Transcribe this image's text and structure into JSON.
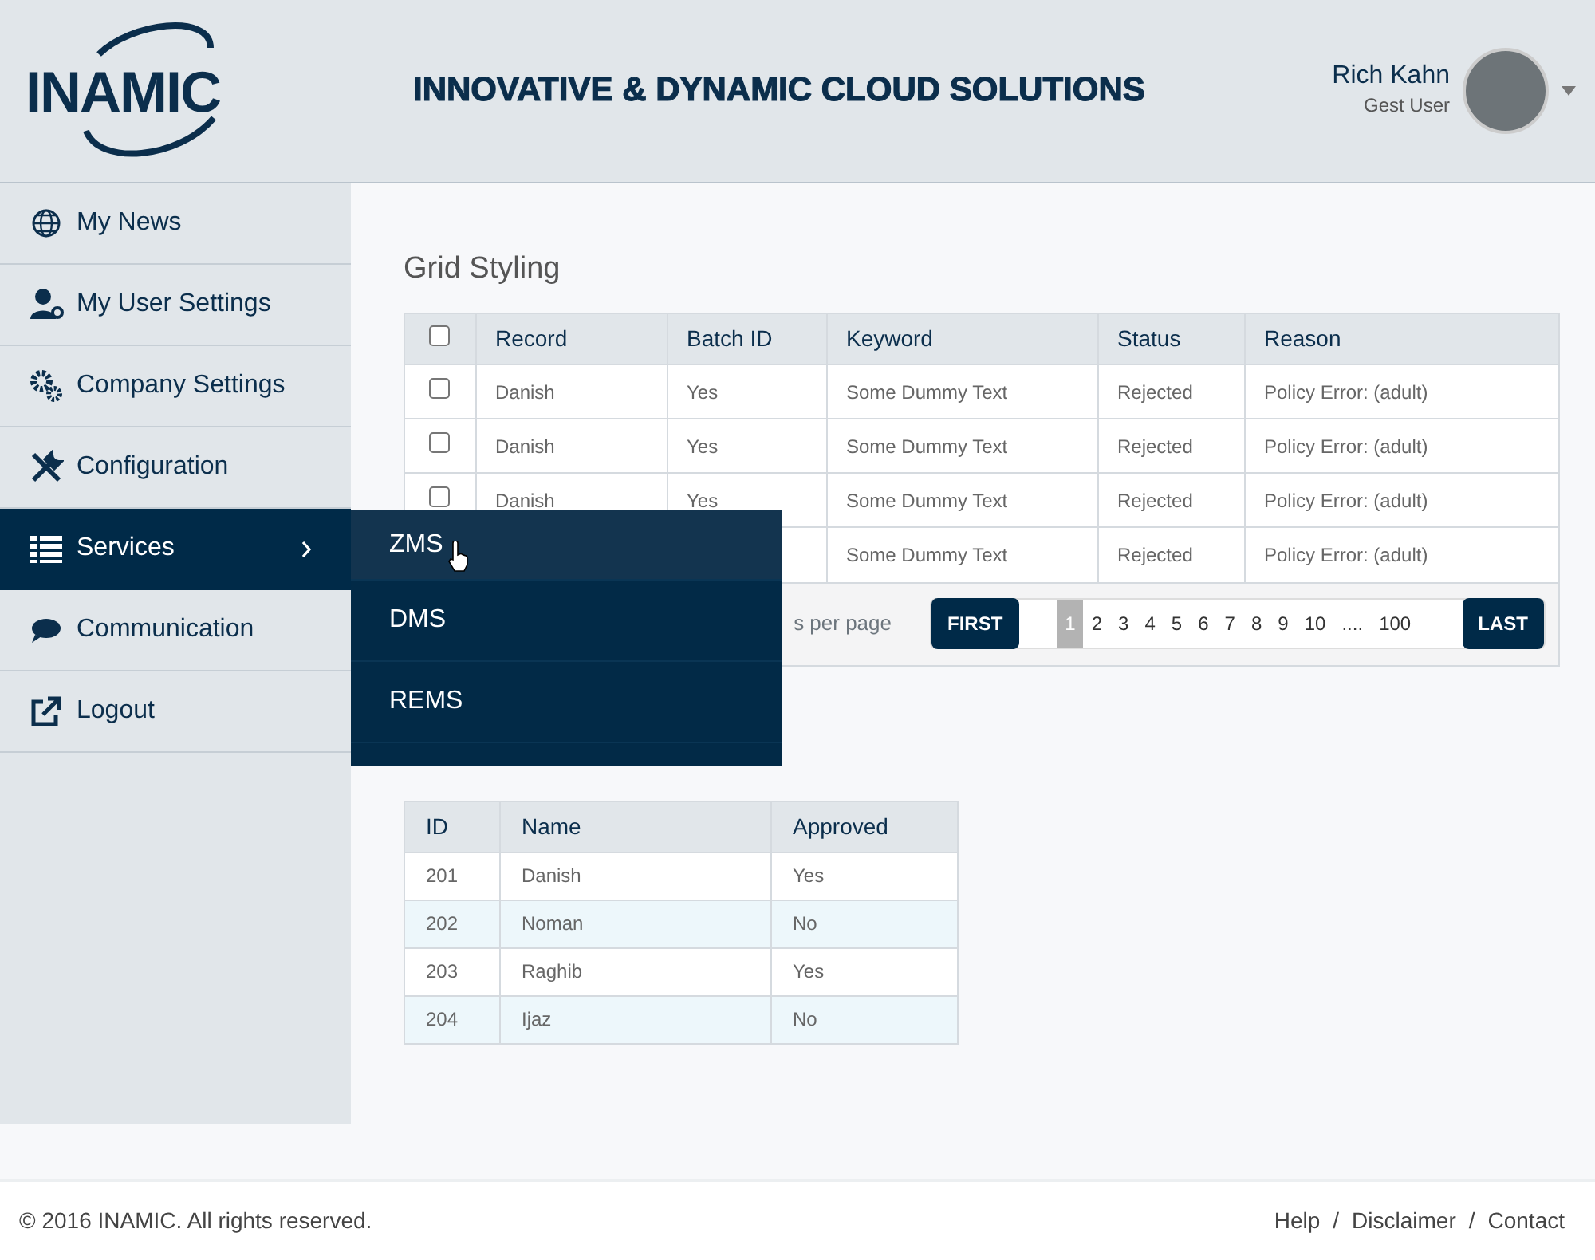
{
  "header": {
    "logo": "INAMIC",
    "tagline": "INNOVATIVE & DYNAMIC CLOUD SOLUTIONS",
    "user": {
      "name": "Rich Kahn",
      "role": "Gest User"
    }
  },
  "sidebar": {
    "items": [
      {
        "label": "My News",
        "selected": false
      },
      {
        "label": "My User Settings",
        "selected": false
      },
      {
        "label": "Company Settings",
        "selected": false
      },
      {
        "label": "Configuration",
        "selected": false
      },
      {
        "label": "Services",
        "selected": true,
        "children": [
          {
            "label": "ZMS",
            "selected": true
          },
          {
            "label": "DMS",
            "selected": false
          },
          {
            "label": "REMS",
            "selected": false
          }
        ]
      },
      {
        "label": "Communication",
        "selected": false
      },
      {
        "label": "Logout",
        "selected": false
      }
    ]
  },
  "grid": {
    "title": "Grid Styling",
    "header_checked": false,
    "columns": [
      "Record",
      "Batch ID",
      "Keyword",
      "Status",
      "Reason"
    ],
    "rows": [
      {
        "checked": false,
        "cells": [
          "Danish",
          "Yes",
          "Some Dummy Text",
          "Rejected",
          "Policy Error: (adult)"
        ]
      },
      {
        "checked": false,
        "cells": [
          "Danish",
          "Yes",
          "Some Dummy Text",
          "Rejected",
          "Policy Error: (adult)"
        ]
      },
      {
        "checked": false,
        "cells": [
          "Danish",
          "Yes",
          "Some Dummy Text",
          "Rejected",
          "Policy Error: (adult)"
        ]
      },
      {
        "checked": null,
        "cells": [
          null,
          null,
          "Some Dummy Text",
          "Rejected",
          "Policy Error: (adult)"
        ]
      }
    ],
    "pager": {
      "label": "s per page",
      "first": "FIRST",
      "last": "LAST",
      "pages": [
        {
          "label": "1",
          "selected": true
        },
        {
          "label": "2",
          "selected": false
        },
        {
          "label": "3",
          "selected": false
        },
        {
          "label": "4",
          "selected": false
        },
        {
          "label": "5",
          "selected": false
        },
        {
          "label": "6",
          "selected": false
        },
        {
          "label": "7",
          "selected": false
        },
        {
          "label": "8",
          "selected": false
        },
        {
          "label": "9",
          "selected": false
        },
        {
          "label": "10",
          "selected": false
        },
        {
          "label": "....",
          "selected": false
        },
        {
          "label": "100",
          "selected": false
        }
      ]
    }
  },
  "table2": {
    "columns": [
      "ID",
      "Name",
      "Approved"
    ],
    "rows": [
      [
        "201",
        "Danish",
        "Yes"
      ],
      [
        "202",
        "Noman",
        "No"
      ],
      [
        "203",
        "Raghib",
        "Yes"
      ],
      [
        "204",
        "Ijaz",
        "No"
      ]
    ]
  },
  "footer": {
    "copyright": "© 2016 INAMIC. All rights reserved.",
    "links": [
      "Help",
      "Disclaimer",
      "Contact"
    ],
    "separator": "/"
  }
}
